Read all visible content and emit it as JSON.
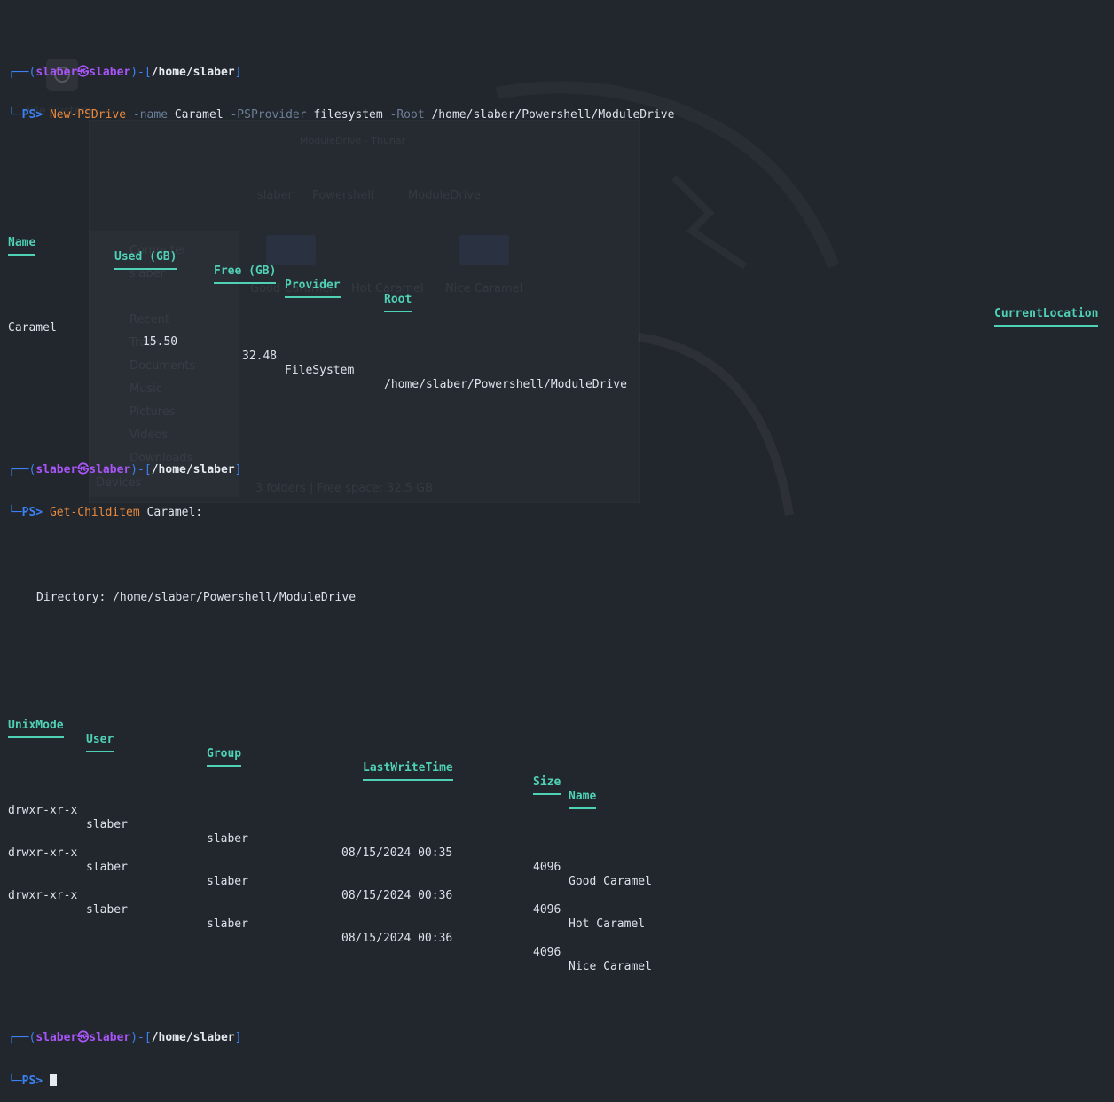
{
  "prompt1": {
    "top_left": "┌──(",
    "user": "slaber㉿slaber",
    "mid": ")-[",
    "path": "/home/slaber",
    "end": "]",
    "bottom": "└─",
    "ps": "PS>",
    "command": "New-PSDrive",
    "p_name": "-name",
    "v_name": "Caramel",
    "p_provider": "-PSProvider",
    "v_provider": "filesystem",
    "p_root": "-Root",
    "v_root": "/home/slaber/Powershell/ModuleDrive"
  },
  "drive_table": {
    "headers": {
      "name": "Name",
      "used": "Used (GB)",
      "free": "Free (GB)",
      "provider": "Provider",
      "root": "Root",
      "current": "CurrentLocation"
    },
    "row": {
      "name": "Caramel",
      "used": "15.50",
      "free": "32.48",
      "provider": "FileSystem",
      "root": "/home/slaber/Powershell/ModuleDrive"
    }
  },
  "prompt2": {
    "top_left": "┌──(",
    "user": "slaber㉿slaber",
    "mid": ")-[",
    "path": "/home/slaber",
    "end": "]",
    "bottom": "└─",
    "ps": "PS>",
    "command": "Get-Childitem",
    "arg": "Caramel:"
  },
  "directory_line": "Directory: /home/slaber/Powershell/ModuleDrive",
  "child_table": {
    "headers": {
      "mode": "UnixMode",
      "user": "User",
      "group": "Group",
      "lwt": "LastWriteTime",
      "size": "Size",
      "name": "Name"
    },
    "rows": [
      {
        "mode": "drwxr-xr-x",
        "user": "slaber",
        "group": "slaber",
        "lwt": "08/15/2024 00:35",
        "size": "4096",
        "name": "Good Caramel"
      },
      {
        "mode": "drwxr-xr-x",
        "user": "slaber",
        "group": "slaber",
        "lwt": "08/15/2024 00:36",
        "size": "4096",
        "name": "Hot Caramel"
      },
      {
        "mode": "drwxr-xr-x",
        "user": "slaber",
        "group": "slaber",
        "lwt": "08/15/2024 00:36",
        "size": "4096",
        "name": "Nice Caramel"
      }
    ]
  },
  "prompt3": {
    "top_left": "┌──(",
    "user": "slaber㉿slaber",
    "mid": ")-[",
    "path": "/home/slaber",
    "end": "]",
    "bottom": "└─",
    "ps": "PS>"
  },
  "background": {
    "file_system": "File System",
    "window_title": "ModuleDrive - Thunar",
    "crumb_home": "slaber",
    "crumb_ps": "Powershell",
    "crumb_md": "ModuleDrive",
    "side_computer": "Computer",
    "side_slaber": "slaber",
    "side_desktop": "Desktop",
    "side_recent": "Recent",
    "side_trash": "Trash",
    "side_documents": "Documents",
    "side_music": "Music",
    "side_pictures": "Pictures",
    "side_videos": "Videos",
    "side_downloads": "Downloads",
    "side_devices": "Devices",
    "folder1": "Good Caramel",
    "folder2": "Hot Caramel",
    "folder3": "Nice Caramel",
    "status": "3 folders  |  Free space: 32.5 GB"
  }
}
